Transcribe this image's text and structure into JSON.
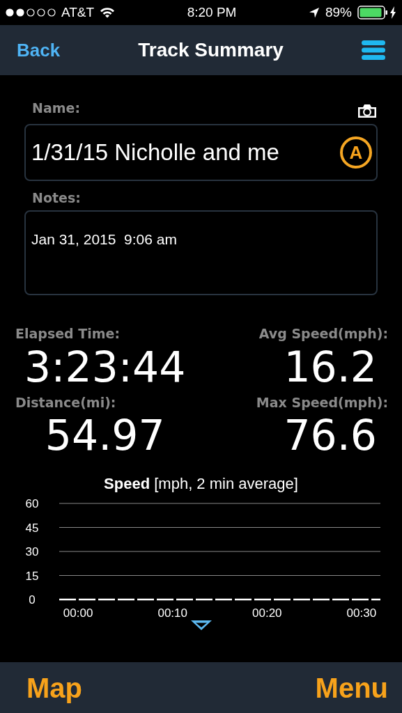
{
  "status_bar": {
    "signal_dots": [
      {
        "filled": true
      },
      {
        "filled": true
      },
      {
        "filled": false
      },
      {
        "filled": false
      },
      {
        "filled": false
      }
    ],
    "carrier": "AT&T",
    "time": "8:20 PM",
    "battery_percent": "89%"
  },
  "nav_bar": {
    "back": "Back",
    "title": "Track Summary"
  },
  "form": {
    "name_label": "Name:",
    "name_value": "1/31/15 Nicholle and me",
    "auto_button": "A",
    "notes_label": "Notes:",
    "notes_value": "Jan 31, 2015  9:06 am"
  },
  "stats": [
    {
      "label": "Elapsed Time:",
      "value": "3:23:44"
    },
    {
      "label": "Avg Speed(mph):",
      "value": "16.2"
    },
    {
      "label": "Distance(mi):",
      "value": "54.97"
    },
    {
      "label": "Max Speed(mph):",
      "value": "76.6"
    }
  ],
  "chart": {
    "title": "**Speed** [mph, 2 min average]",
    "chart_data": {
      "type": "line",
      "x": [
        -2,
        32
      ],
      "grid": true,
      "series": [
        {
          "color": "#ffffff",
          "line_style": "dashed",
          "values": [
            0,
            0
          ]
        }
      ],
      "xlim": [
        -2,
        32
      ],
      "ylim": [
        0,
        60
      ],
      "xticks": [
        {
          "value": 0,
          "label": "00:00"
        },
        {
          "value": 10,
          "label": "00:10"
        },
        {
          "value": 20,
          "label": "00:20"
        },
        {
          "value": 30,
          "label": "00:30"
        }
      ],
      "yticks": [
        0,
        15,
        30,
        45,
        60
      ]
    }
  },
  "bottom_bar": {
    "left": "Map",
    "right": "Menu"
  }
}
